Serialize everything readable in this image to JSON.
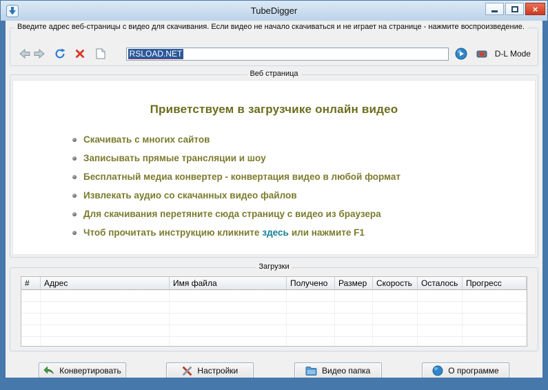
{
  "window": {
    "title": "TubeDigger"
  },
  "toolbar": {
    "instruction": "Введите адрес веб-страницы с видео для скачивания. Если видео не начало скачиваться и не играет на странице - нажмите воспроизведение.",
    "url_value": "RSLOAD.NET",
    "dl_mode_label": "D-L Mode"
  },
  "webpage": {
    "group_label": "Веб страница",
    "heading": "Приветствуем в загрузчике онлайн видео",
    "bullets": [
      "Скачивать с многих сайтов",
      "Записывать прямые трансляции и шоу",
      "Бесплатный медиа конвертер - конвертация видео в любой формат",
      "Извлекать аудио со скачанных видео файлов",
      "Для скачивания перетяните сюда страницу с видео из браузера"
    ],
    "instruction_bullet_pre": "Чтоб прочитать инструкцию кликните",
    "instruction_bullet_link": "здесь",
    "instruction_bullet_post": "или нажмите F1"
  },
  "downloads": {
    "group_label": "Загрузки",
    "columns": [
      "#",
      "Адрес",
      "Имя файла",
      "Получено",
      "Размер",
      "Скорость",
      "Осталось",
      "Прогресс"
    ]
  },
  "footer": {
    "convert_label": "Конвертировать",
    "settings_label": "Настройки",
    "video_folder_label": "Видео папка",
    "about_label": "О программе"
  },
  "colors": {
    "window_border": "#4678ab",
    "titlebar": "#c6daec",
    "welcome_heading": "#6d6d1f",
    "welcome_text": "#7b7b2e",
    "link": "#157f95",
    "close_button": "#cd3a21",
    "selection": "#2b579a"
  }
}
